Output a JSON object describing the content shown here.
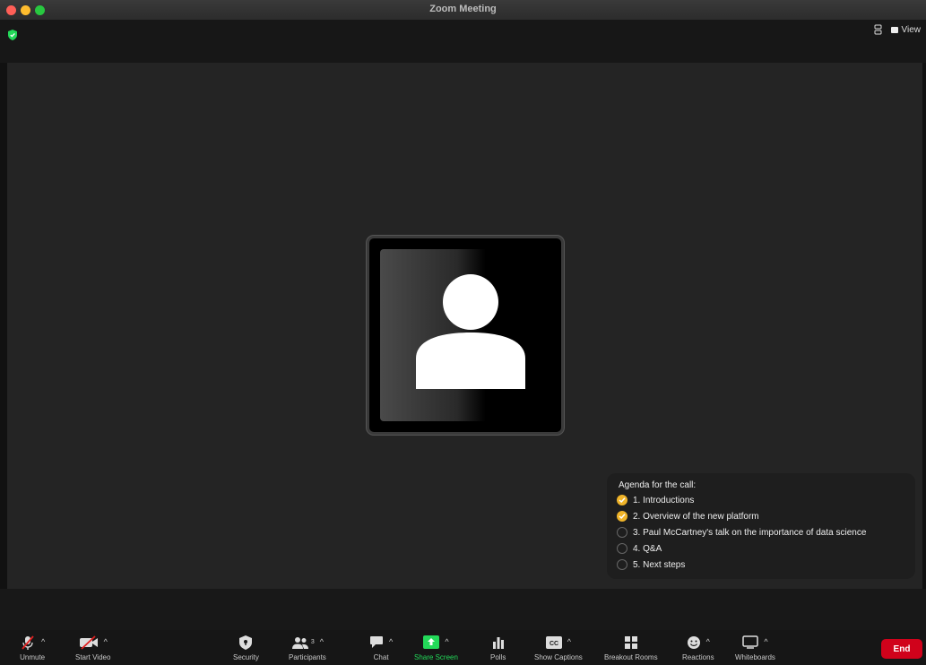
{
  "window": {
    "title": "Zoom Meeting"
  },
  "topbar": {
    "view_label": "View"
  },
  "agenda": {
    "title": "Agenda for the call:",
    "items": [
      {
        "label": "1. Introductions",
        "done": true
      },
      {
        "label": "2. Overview of the new platform",
        "done": true
      },
      {
        "label": "3. Paul McCartney's talk on the importance of data science",
        "done": false
      },
      {
        "label": "4. Q&A",
        "done": false
      },
      {
        "label": "5. Next steps",
        "done": false
      }
    ]
  },
  "toolbar": {
    "unmute": "Unmute",
    "start_video": "Start Video",
    "security": "Security",
    "participants": "Participants",
    "participants_count": "3",
    "chat": "Chat",
    "share_screen": "Share Screen",
    "polls": "Polls",
    "show_captions": "Show Captions",
    "breakout_rooms": "Breakout Rooms",
    "reactions": "Reactions",
    "whiteboards": "Whiteboards",
    "end": "End"
  },
  "colors": {
    "share_green": "#23d959",
    "end_red": "#d0021b",
    "check_yellow": "#f0b429",
    "security_green": "#23d959"
  }
}
